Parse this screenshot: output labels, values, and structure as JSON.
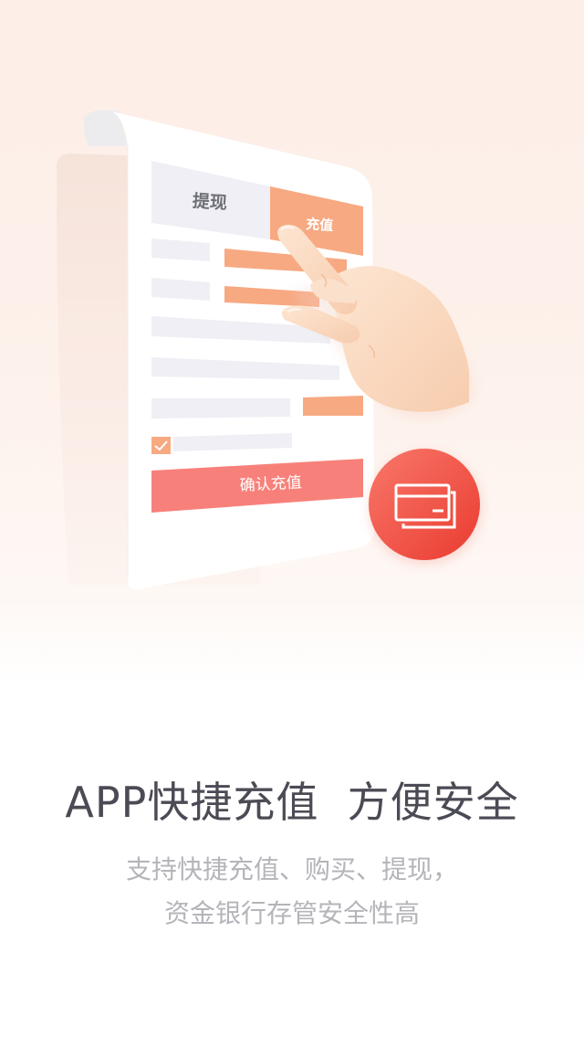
{
  "form_card": {
    "tab_withdraw": "提现",
    "tab_recharge": "充值",
    "confirm_button": "确认充值",
    "agree_checked": true
  },
  "icons": {
    "card_icon": "credit-card-icon",
    "hand_icon": "pointing-hand-illustration",
    "check_icon": "checkmark-icon"
  },
  "colors": {
    "accent_orange": "#f7a982",
    "confirm_red": "#f7817a",
    "badge_red": "#f04a3a",
    "tab_gray": "#efeff5",
    "headline": "#4b4b55",
    "subtitle": "#b4b4ba"
  },
  "headline": "APP快捷充值  方便安全",
  "subtitle": {
    "line1": "支持快捷充值、购买、提现，",
    "line2": "资金银行存管安全性高"
  }
}
